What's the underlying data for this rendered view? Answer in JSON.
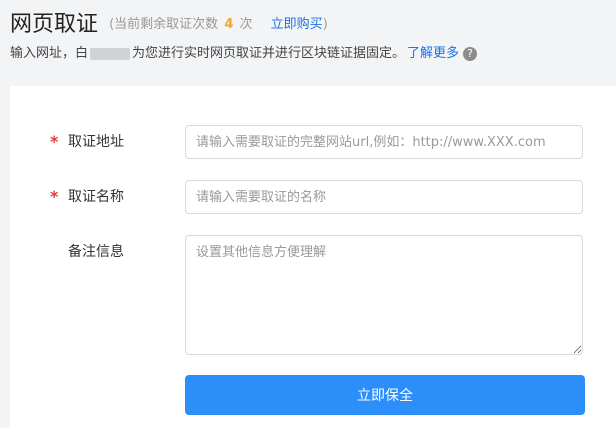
{
  "header": {
    "title": "网页取证",
    "remain_prefix": "(当前剩余取证次数",
    "remain_count": "4",
    "remain_unit": "次",
    "buy_label": "立即购买",
    "remain_suffix": ")"
  },
  "subline": {
    "text_before": "输入网址，白",
    "text_after": "为您进行实时网页取证并进行区块链证据固定。",
    "learn_more": "了解更多",
    "help_icon": "?"
  },
  "form": {
    "url": {
      "required_mark": "*",
      "label": "取证地址",
      "placeholder": "请输入需要取证的完整网站url,例如：http://www.XXX.com"
    },
    "name": {
      "required_mark": "*",
      "label": "取证名称",
      "placeholder": "请输入需要取证的名称"
    },
    "note": {
      "label": "备注信息",
      "placeholder": "设置其他信息方便理解"
    },
    "submit_label": "立即保全"
  },
  "colors": {
    "accent": "#2c8ef8",
    "link": "#1a73e8",
    "required": "#e53935",
    "count": "#f5a623"
  }
}
